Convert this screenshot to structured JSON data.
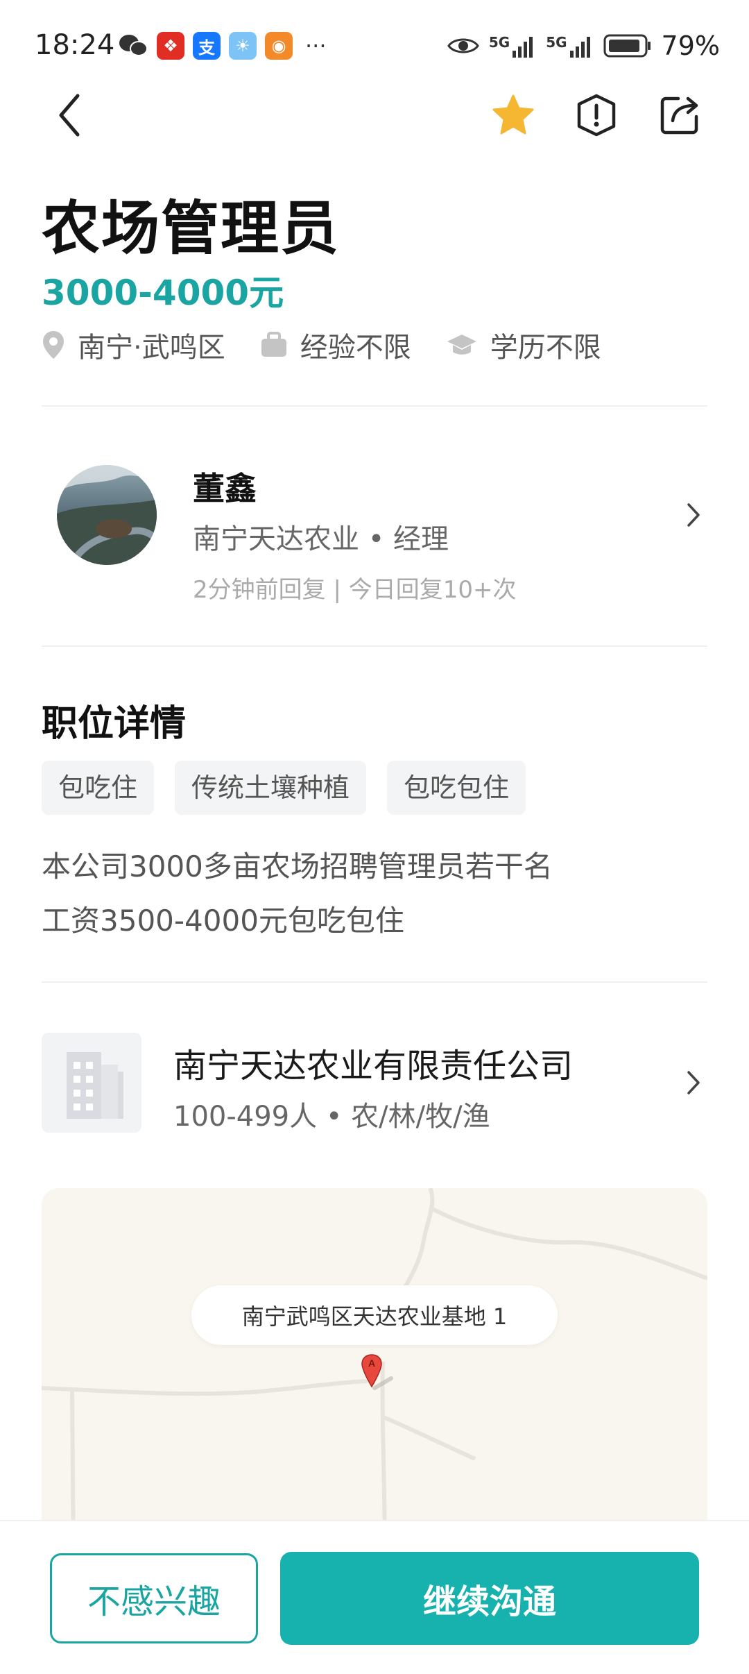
{
  "status_bar": {
    "time": "18:24",
    "network_1": "5G",
    "network_2": "5G",
    "battery": "79%"
  },
  "nav": {
    "back_icon": "chevron-left-icon",
    "favorite_icon": "star-icon",
    "report_icon": "alert-icon",
    "share_icon": "share-icon",
    "accent_star": "#f5b731"
  },
  "job": {
    "title": "农场管理员",
    "salary": "3000-4000元",
    "location": "南宁·武鸣区",
    "experience": "经验不限",
    "education": "学历不限"
  },
  "recruiter": {
    "name": "董鑫",
    "company_role": "南宁天达农业 • 经理",
    "reply": "2分钟前回复 | 今日回复10+次"
  },
  "details": {
    "title": "职位详情",
    "tags": [
      "包吃住",
      "传统土壤种植",
      "包吃包住"
    ],
    "description_lines": [
      "本公司3000多亩农场招聘管理员若干名",
      "工资3500-4000元包吃包住"
    ]
  },
  "company": {
    "name": "南宁天达农业有限责任公司",
    "info": "100-499人 • 农/林/牧/渔"
  },
  "map": {
    "label": "南宁武鸣区天达农业基地 1",
    "pin_letter": "A"
  },
  "actions": {
    "not_interested": "不感兴趣",
    "continue_chat": "继续沟通"
  },
  "colors": {
    "accent": "#1aa5a2",
    "button_primary": "#17b2ad"
  }
}
